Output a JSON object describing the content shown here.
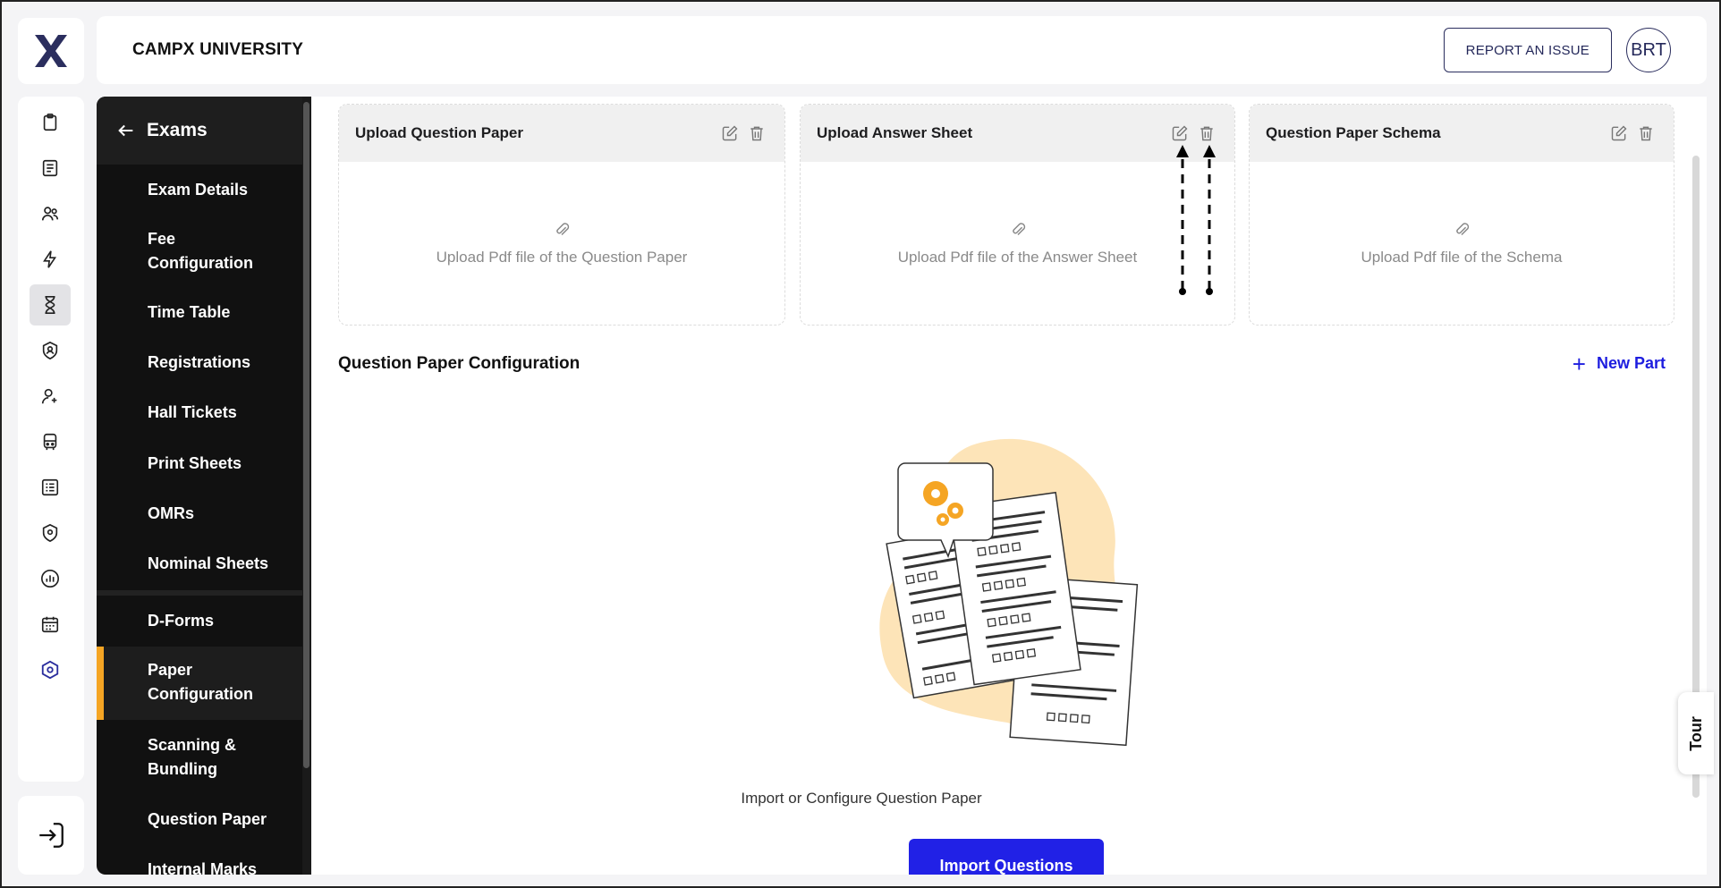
{
  "header": {
    "university": "CAMPX UNIVERSITY",
    "report_button": "REPORT AN ISSUE",
    "avatar_initials": "BRT"
  },
  "rail": {
    "icons": [
      "clipboard-icon",
      "document-icon",
      "users-icon",
      "lightning-icon",
      "hourglass-icon",
      "shield-user-icon",
      "user-plus-icon",
      "bus-icon",
      "list-document-icon",
      "shield-pin-icon",
      "chart-icon",
      "calendar-icon",
      "hexagon-settings-icon"
    ],
    "active_index": 4,
    "logout_icon": "logout-icon"
  },
  "sidebar": {
    "title": "Exams",
    "items": [
      {
        "label": "Exam Details"
      },
      {
        "label": "Fee Configuration"
      },
      {
        "label": "Time Table"
      },
      {
        "label": "Registrations"
      },
      {
        "label": "Hall Tickets"
      },
      {
        "label": "Print Sheets"
      },
      {
        "label": "OMRs"
      },
      {
        "label": "Nominal Sheets"
      },
      {
        "label": "D-Forms"
      },
      {
        "label": "Paper Configuration",
        "active": true
      },
      {
        "label": "Scanning & Bundling"
      },
      {
        "label": "Question Paper"
      },
      {
        "label": "Internal Marks"
      }
    ],
    "accent_color": "#f5a524"
  },
  "uploads": [
    {
      "title": "Upload Question Paper",
      "hint": "Upload Pdf file of the Question Paper"
    },
    {
      "title": "Upload Answer Sheet",
      "hint": "Upload Pdf file of the Answer Sheet"
    },
    {
      "title": "Question Paper Schema",
      "hint": "Upload Pdf file of the Schema"
    }
  ],
  "config": {
    "title": "Question Paper Configuration",
    "new_part": "New Part",
    "empty_text": "Import or Configure Question Paper",
    "import_button": "Import Questions"
  },
  "tour_label": "Tour",
  "colors": {
    "primary": "#2121e6",
    "accent": "#f5a524",
    "brand": "#2b2e5e"
  }
}
